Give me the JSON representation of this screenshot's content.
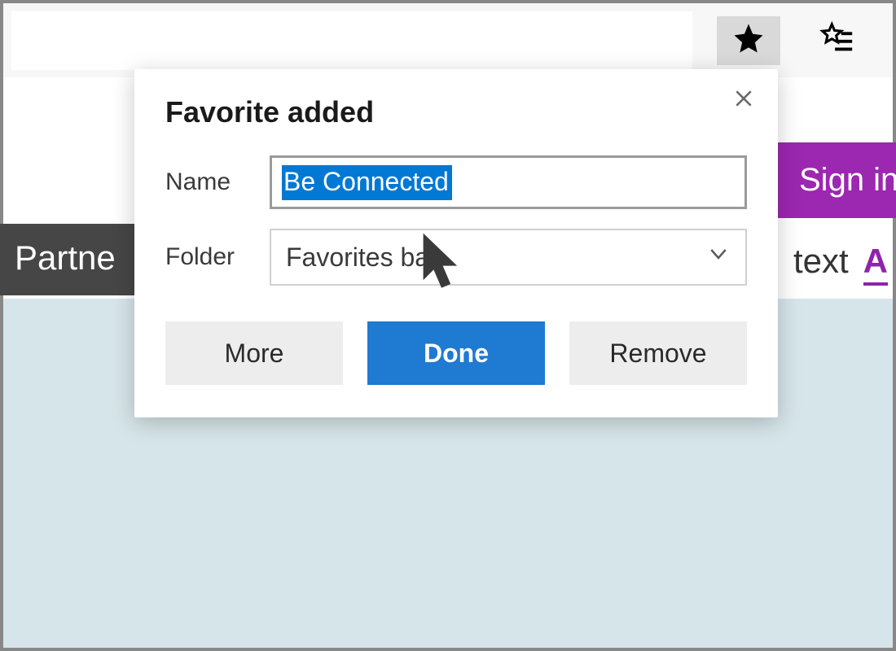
{
  "toolbar": {
    "star_filled": true
  },
  "page": {
    "signin_label": "Sign in",
    "partner_label": "Partne",
    "text_label": "text",
    "link_a_label": "A"
  },
  "popup": {
    "title": "Favorite added",
    "name_label": "Name",
    "name_value": "Be Connected",
    "folder_label": "Folder",
    "folder_value": "Favorites bar",
    "more_label": "More",
    "done_label": "Done",
    "remove_label": "Remove"
  }
}
